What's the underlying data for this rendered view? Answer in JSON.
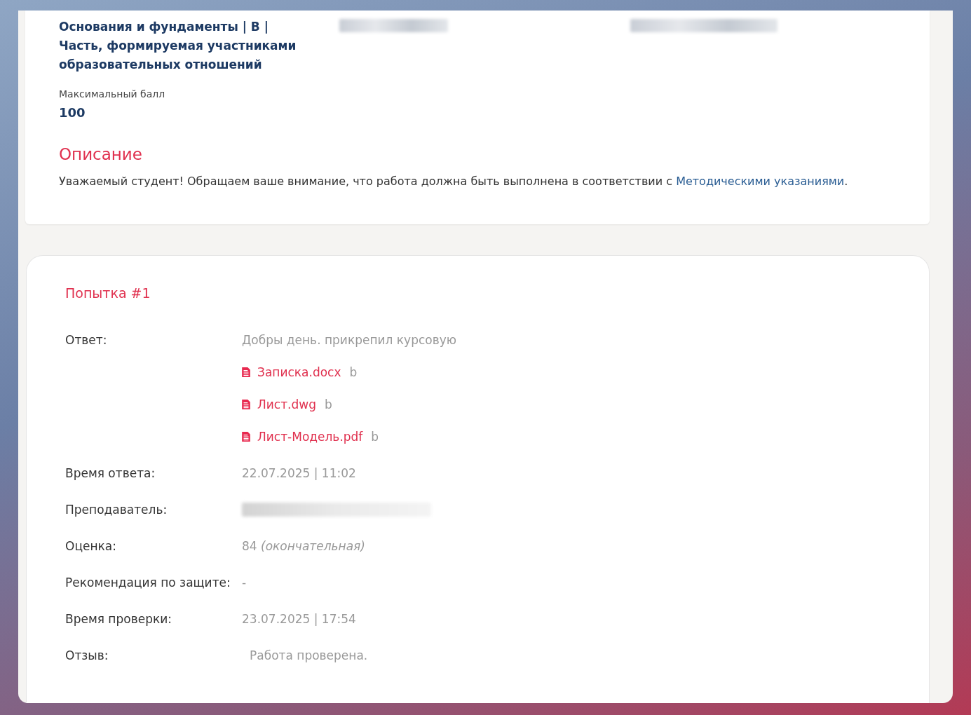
{
  "course": {
    "title": "Основания и фундаменты | В | Часть, формируемая участниками образовательных отношений",
    "max_score_label": "Максимальный балл",
    "max_score": "100"
  },
  "description": {
    "heading": "Описание",
    "text": "Уважаемый студент! Обращаем ваше внимание, что работа должна быть выполнена в соответствии с ",
    "link": "Методическими указаниями",
    "end": "."
  },
  "attempt": {
    "title": "Попытка #1",
    "rows": [
      {
        "kind": "answer",
        "label": "Ответ:",
        "value": "Добры день. прикрепил курсовую",
        "files": [
          {
            "name": "Записка.docx",
            "size": "b"
          },
          {
            "name": "Лист.dwg",
            "size": "b"
          },
          {
            "name": "Лист-Модель.pdf",
            "size": "b"
          }
        ]
      },
      {
        "kind": "text",
        "label": "Время ответа:",
        "value": "22.07.2025 | 11:02"
      },
      {
        "kind": "hidden",
        "label": "Преподаватель:"
      },
      {
        "kind": "grade",
        "label": "Оценка:",
        "value": "84",
        "note": "(окончательная)"
      },
      {
        "kind": "text",
        "label": "Рекомендация по защите:",
        "value": "-"
      },
      {
        "kind": "text",
        "label": "Время проверки:",
        "value": "23.07.2025 | 17:54"
      },
      {
        "kind": "feedback",
        "label": "Отзыв:",
        "value": "Работа проверена."
      }
    ]
  }
}
